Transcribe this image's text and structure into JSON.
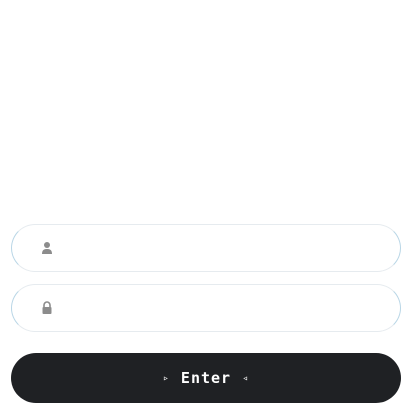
{
  "login": {
    "username": {
      "icon": "user-icon",
      "value": "",
      "placeholder": ""
    },
    "password": {
      "icon": "lock-icon",
      "value": "",
      "placeholder": ""
    },
    "submit": {
      "label": "Enter",
      "left_glyph": "▹",
      "right_glyph": "◃"
    }
  },
  "colors": {
    "button_bg": "#1f2124",
    "button_text": "#ffffff",
    "icon": "#8c8c8c",
    "field_border": "#b9d6e6"
  }
}
